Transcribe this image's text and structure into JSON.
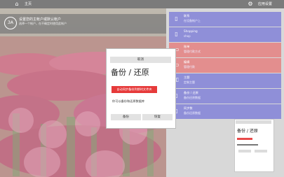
{
  "topbar": {
    "home_icon": "home-icon",
    "home_label": "主页",
    "settings_icon": "gear-icon",
    "settings_label": "应用设置"
  },
  "account": {
    "icon_text": "ЗA",
    "title": "设置您的主帐户或默认帐户",
    "subtitle": "选择一个帐户，在不确定时使用此帐户"
  },
  "tiles": [
    {
      "icon": "phone-icon",
      "title": "联系",
      "subtitle": "在设备帐户上",
      "color": "#8f8fd8"
    },
    {
      "icon": "phone-icon",
      "title": "Shopping",
      "subtitle": "shop",
      "color": "#8f8fd8"
    },
    {
      "icon": "card-icon",
      "title": "账单",
      "subtitle": "管理付款方式",
      "color": "#e38e8e"
    },
    {
      "icon": "card-icon",
      "title": "编辑",
      "subtitle": "管理付款",
      "color": "#e38e8e"
    },
    {
      "icon": "key-icon",
      "title": "主题",
      "subtitle": "定制主题",
      "color": "#8f8fd8"
    },
    {
      "icon": "phone-icon",
      "title": "备份 / 还原",
      "subtitle": "备份还原数据",
      "color": "#8f8fd8"
    },
    {
      "icon": "phone-icon",
      "title": "同步数",
      "subtitle": "备份还原数据",
      "color": "#8f8fd8"
    }
  ],
  "mini_preview": {
    "title": "备份 / 还原"
  },
  "dialog": {
    "cancel": "取消",
    "title": "备份 / 还原",
    "red_button": "自动同步备份到期时文件夹",
    "description": "你可以备份和还原数据库",
    "backup": "备份",
    "restore": "恢复"
  }
}
